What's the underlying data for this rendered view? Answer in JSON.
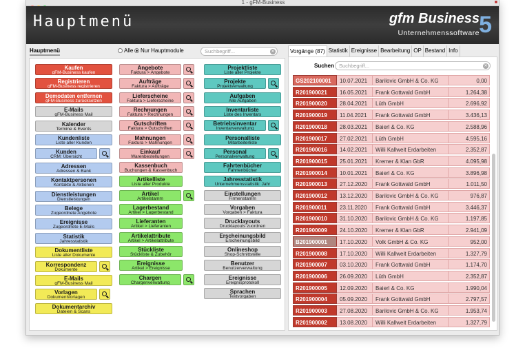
{
  "window": {
    "title": "1 - gFM-Business"
  },
  "header": {
    "page_title": "Hauptmenü",
    "brand": "gfm Business",
    "brand_sub": "Unternehmenssoftware",
    "brand_version": "5"
  },
  "nav": {
    "tab_label": "Hauptmenü",
    "radio_all": "Alle",
    "radio_main": "Nur Hauptmodule",
    "search_placeholder": "Suchbegriff..."
  },
  "menu": {
    "col1": [
      {
        "title": "Kaufen",
        "sub": "gFM-Business kaufen",
        "color": "red"
      },
      {
        "title": "Registrieren",
        "sub": "gFM-Business registrieren",
        "color": "red"
      },
      {
        "title": "Demodaten entfernen",
        "sub": "gFM-Business zurücksetzen",
        "color": "red"
      },
      {
        "title": "E-Mails",
        "sub": "gFM-Business Mail",
        "color": "gray"
      },
      {
        "title": "Kalender",
        "sub": "Termine & Events",
        "color": "gray"
      },
      {
        "title": "Kundenliste",
        "sub": "Liste aller Kunden",
        "color": "blue"
      },
      {
        "title": "Kunden",
        "sub": "CRM: Übersicht",
        "color": "blue",
        "search": true
      },
      {
        "title": "Adressen",
        "sub": "Adressen & Bank",
        "color": "blue"
      },
      {
        "title": "Kontaktpersonen",
        "sub": "Kontakte & Aktionen",
        "color": "blue"
      },
      {
        "title": "Dienstleistungen",
        "sub": "Dienstleistungen",
        "color": "blue"
      },
      {
        "title": "Belege",
        "sub": "Zugeordnete Angebote",
        "color": "blue"
      },
      {
        "title": "Ereignisse",
        "sub": "Zugeordnete E-Mails",
        "color": "blue"
      },
      {
        "title": "Statistik",
        "sub": "Jahresstatistik",
        "color": "blue"
      },
      {
        "title": "Dokumentliste",
        "sub": "Liste aller Dokumente",
        "color": "yellow"
      },
      {
        "title": "Korrespondenz",
        "sub": "Dokumente",
        "color": "yellow",
        "search": true
      },
      {
        "title": "E-Mails",
        "sub": "gFM-Business Mail",
        "color": "yellow"
      },
      {
        "title": "Vorlagen",
        "sub": "Dokumentvorlagen",
        "color": "yellow",
        "search": true
      },
      {
        "title": "Dokumentarchiv",
        "sub": "Dateien & Scans",
        "color": "yellow"
      }
    ],
    "col2": [
      {
        "title": "Angebote",
        "sub": "Faktura > Angebote",
        "color": "pink",
        "search": true
      },
      {
        "title": "Aufträge",
        "sub": "Faktura > Aufträge",
        "color": "pink",
        "search": true
      },
      {
        "title": "Lieferscheine",
        "sub": "Faktura > Lieferscheine",
        "color": "pink",
        "search": true
      },
      {
        "title": "Rechnungen",
        "sub": "Faktura > Rechnungen",
        "color": "pink",
        "search": true
      },
      {
        "title": "Gutschriften",
        "sub": "Faktura > Gutschriften",
        "color": "pink",
        "search": true
      },
      {
        "title": "Mahnungen",
        "sub": "Faktura > Mahnungen",
        "color": "pink",
        "search": true
      },
      {
        "title": "Einkauf",
        "sub": "Warenbestellungen",
        "color": "pink",
        "search": true
      },
      {
        "title": "Kassenbuch",
        "sub": "Buchungen & Kassenbuch",
        "color": "pink"
      },
      {
        "title": "Artikelliste",
        "sub": "Liste aller Produkte",
        "color": "green"
      },
      {
        "title": "Artikel",
        "sub": "Artikelstamm",
        "color": "green",
        "search": true
      },
      {
        "title": "Lagerbestand",
        "sub": "Artikel > Lagerbestand",
        "color": "green"
      },
      {
        "title": "Lieferanten",
        "sub": "Artikel > Lieferanten",
        "color": "green"
      },
      {
        "title": "Artikelattribute",
        "sub": "Artikel > Artikelattribute",
        "color": "green"
      },
      {
        "title": "Stückliste",
        "sub": "Stückliste & Zubehör",
        "color": "green"
      },
      {
        "title": "Ereignisse",
        "sub": "Artikel > Ereignisse",
        "color": "green"
      },
      {
        "title": "Chargen",
        "sub": "Chargenverwaltung",
        "color": "green",
        "search": true
      }
    ],
    "col3": [
      {
        "title": "Projektliste",
        "sub": "Liste aller Projekte",
        "color": "teal"
      },
      {
        "title": "Projekte",
        "sub": "Projektverwaltung",
        "color": "teal",
        "search": true
      },
      {
        "title": "Aufgaben",
        "sub": "Alle Aufgaben",
        "color": "teal"
      },
      {
        "title": "Inventarliste",
        "sub": "Liste des Inventars",
        "color": "teal"
      },
      {
        "title": "Betriebsinventar",
        "sub": "Inventarverwaltung",
        "color": "teal",
        "search": true
      },
      {
        "title": "Personalliste",
        "sub": "Mitarbeiterliste",
        "color": "teal"
      },
      {
        "title": "Personal",
        "sub": "Personalverwaltung",
        "color": "teal",
        "search": true
      },
      {
        "title": "Fahrtenbücher",
        "sub": "Fahrtenbücher",
        "color": "teal"
      },
      {
        "title": "Jahresstatistik",
        "sub": "Unternehmensstatistik: Jahr",
        "color": "teal"
      },
      {
        "title": "Einstellungen",
        "sub": "Firmenstamm",
        "color": "gray"
      },
      {
        "title": "Vorgaben",
        "sub": "Vorgaben > Faktura",
        "color": "gray"
      },
      {
        "title": "Drucklayouts",
        "sub": "Drucklayouts zuordnen",
        "color": "gray"
      },
      {
        "title": "Erscheinungsbild",
        "sub": "Erscheinungsbild",
        "color": "gray"
      },
      {
        "title": "Onlineshop",
        "sub": "Shop-Schnittstelle",
        "color": "gray"
      },
      {
        "title": "Benutzer",
        "sub": "Benutzerverwaltung",
        "color": "gray"
      },
      {
        "title": "Ereignisse",
        "sub": "Ereignisprotokoll",
        "color": "gray"
      },
      {
        "title": "Sprachen",
        "sub": "Textvorgaben",
        "color": "gray"
      }
    ]
  },
  "right": {
    "tabs": [
      "Vorgänge (87)",
      "Statistik",
      "Ereignisse",
      "Bearbeitung",
      "OP",
      "Bestand",
      "Info"
    ],
    "selected_tab": 0,
    "search_label": "Suchen",
    "search_placeholder": "Suchbegriff...",
    "rows": [
      {
        "id": "GS202100001",
        "date": "10.07.2021",
        "company": "Barilovic GmbH & Co. KG",
        "amount": "0,00",
        "kind": "gutschrift"
      },
      {
        "id": "R201900021",
        "date": "16.05.2021",
        "company": "Frank Gottwald GmbH",
        "amount": "1.264,38",
        "kind": "rechnung"
      },
      {
        "id": "R201900020",
        "date": "28.04.2021",
        "company": "Lüth GmbH",
        "amount": "2.696,92",
        "kind": "rechnung"
      },
      {
        "id": "R201900019",
        "date": "11.04.2021",
        "company": "Frank Gottwald GmbH",
        "amount": "3.436,13",
        "kind": "rechnung"
      },
      {
        "id": "R201900018",
        "date": "28.03.2021",
        "company": "Baierl & Co. KG",
        "amount": "2.588,96",
        "kind": "rechnung"
      },
      {
        "id": "R201900017",
        "date": "27.02.2021",
        "company": "Lüth GmbH",
        "amount": "4.595,16",
        "kind": "rechnung"
      },
      {
        "id": "R201900016",
        "date": "14.02.2021",
        "company": "Willi Kallweit Erdarbeiten",
        "amount": "2.352,87",
        "kind": "rechnung"
      },
      {
        "id": "R201900015",
        "date": "25.01.2021",
        "company": "Kremer & Klan GbR",
        "amount": "4.095,98",
        "kind": "rechnung"
      },
      {
        "id": "R201900014",
        "date": "10.01.2021",
        "company": "Baierl & Co. KG",
        "amount": "3.896,98",
        "kind": "rechnung"
      },
      {
        "id": "R201900013",
        "date": "27.12.2020",
        "company": "Frank Gottwald GmbH",
        "amount": "1.011,50",
        "kind": "rechnung"
      },
      {
        "id": "R201900012",
        "date": "13.12.2020",
        "company": "Barilovic GmbH & Co. KG",
        "amount": "976,87",
        "kind": "rechnung"
      },
      {
        "id": "R201900011",
        "date": "23.11.2020",
        "company": "Frank Gottwald GmbH",
        "amount": "3.446,37",
        "kind": "rechnung"
      },
      {
        "id": "R201900010",
        "date": "31.10.2020",
        "company": "Barilovic GmbH & Co. KG",
        "amount": "1.197,85",
        "kind": "rechnung"
      },
      {
        "id": "R201900009",
        "date": "24.10.2020",
        "company": "Kremer & Klan GbR",
        "amount": "2.941,09",
        "kind": "rechnung"
      },
      {
        "id": "B201900001",
        "date": "17.10.2020",
        "company": "Volk GmbH & Co. KG",
        "amount": "952,00",
        "kind": "bestellung"
      },
      {
        "id": "R201900008",
        "date": "17.10.2020",
        "company": "Willi Kallweit Erdarbeiten",
        "amount": "1.327,79",
        "kind": "rechnung"
      },
      {
        "id": "R201900007",
        "date": "03.10.2020",
        "company": "Frank Gottwald GmbH",
        "amount": "1.174,70",
        "kind": "rechnung"
      },
      {
        "id": "R201900006",
        "date": "26.09.2020",
        "company": "Lüth GmbH",
        "amount": "2.352,87",
        "kind": "rechnung"
      },
      {
        "id": "R201900005",
        "date": "12.09.2020",
        "company": "Baierl & Co. KG",
        "amount": "1.990,04",
        "kind": "rechnung"
      },
      {
        "id": "R201900004",
        "date": "05.09.2020",
        "company": "Frank Gottwald GmbH",
        "amount": "2.797,57",
        "kind": "rechnung"
      },
      {
        "id": "R201900003",
        "date": "27.08.2020",
        "company": "Barilovic GmbH & Co. KG",
        "amount": "1.953,74",
        "kind": "rechnung"
      },
      {
        "id": "R201900002",
        "date": "13.08.2020",
        "company": "Willi Kallweit Erdarbeiten",
        "amount": "1.327,79",
        "kind": "rechnung"
      }
    ]
  },
  "colors": {
    "rechnung": "#c0392b",
    "gutschrift": "#d9695e",
    "bestellung": "#b0867f"
  }
}
